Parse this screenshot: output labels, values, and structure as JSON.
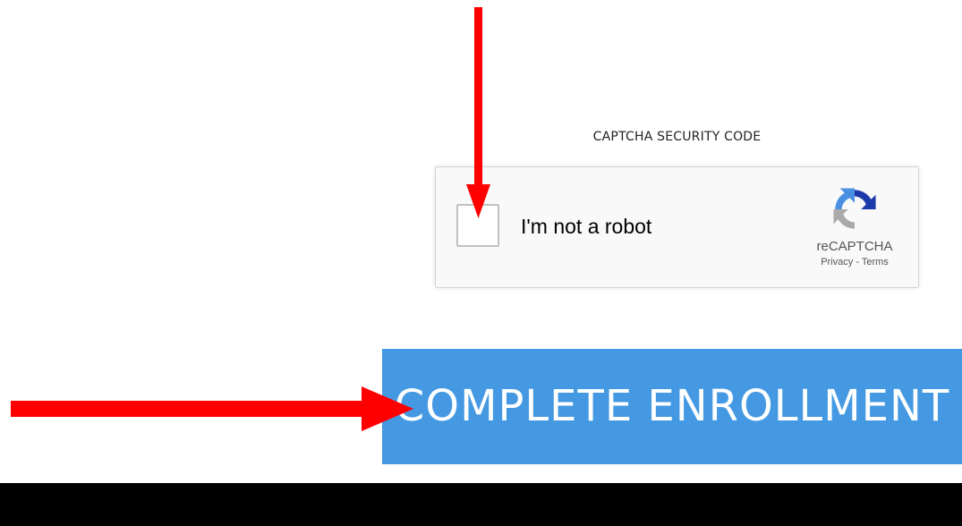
{
  "captcha_section": {
    "title": "CAPTCHA SECURITY CODE"
  },
  "recaptcha": {
    "label": "I'm not a robot",
    "checked": false,
    "brand": "reCAPTCHA",
    "privacy_link": "Privacy",
    "separator": "-",
    "terms_link": "Terms",
    "logo_icon": "recaptcha-logo-icon"
  },
  "form": {
    "submit_label": "COMPLETE ENROLLMENT"
  },
  "annotations": {
    "arrow_color": "#ff0000",
    "arrows": [
      "down-arrow-to-checkbox",
      "right-arrow-to-button"
    ]
  },
  "colors": {
    "button": "#4499e2",
    "recaptcha_blue": "#1c3aa9",
    "recaptcha_lightblue": "#4a90e2",
    "recaptcha_gray": "#aaaaaa"
  }
}
